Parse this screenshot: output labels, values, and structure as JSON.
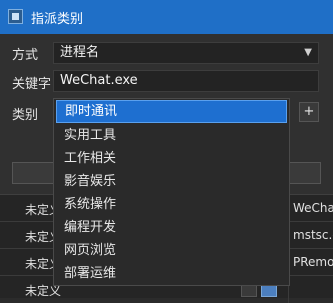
{
  "window": {
    "title": "指派类别"
  },
  "form": {
    "method_label": "方式",
    "method_value": "进程名",
    "keyword_label": "关键字",
    "keyword_value": "WeChat.exe",
    "category_label": "类别",
    "add_button": "+"
  },
  "dropdown": {
    "items": [
      "即时通讯",
      "实用工具",
      "工作相关",
      "影音娱乐",
      "系统操作",
      "编程开发",
      "网页浏览",
      "部署运维"
    ],
    "selected": "即时通讯"
  },
  "table": {
    "rows": [
      {
        "category": "未定义",
        "process": "WeCha"
      },
      {
        "category": "未定义",
        "process": "mstsc.e"
      },
      {
        "category": "未定义",
        "process": "PRemo"
      },
      {
        "category": "未定义",
        "process": ""
      }
    ]
  },
  "icons": {
    "app": "app-icon",
    "dropdown_arrow": "chevron-down-icon"
  },
  "colors": {
    "titlebar": "#1f6fc7",
    "selection": "#1e6fd0"
  }
}
